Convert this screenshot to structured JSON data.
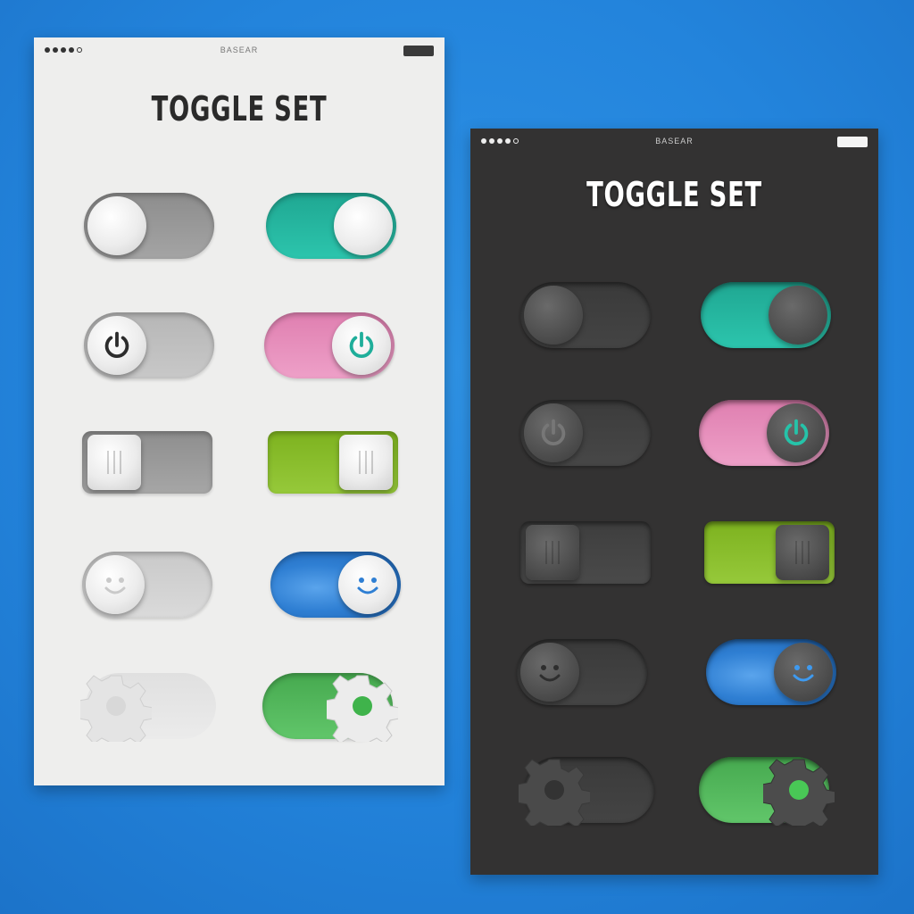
{
  "light_phone": {
    "carrier": "BASEAR",
    "title": "TOGGLE SET"
  },
  "dark_phone": {
    "carrier": "BASEAR",
    "title": "TOGGLE SET"
  },
  "colors": {
    "teal": "#27bea6",
    "pink": "#e890bd",
    "lime": "#8cbe2a",
    "blue": "#3e8fe0",
    "green": "#55bf5f"
  },
  "toggles": [
    {
      "row": 1,
      "style": "plain",
      "icon": "none",
      "off_state": "off",
      "on_state": "on",
      "on_color": "teal"
    },
    {
      "row": 2,
      "style": "power",
      "icon": "power-icon",
      "off_state": "off",
      "on_state": "on",
      "on_color": "pink"
    },
    {
      "row": 3,
      "style": "grip",
      "icon": "grip-icon",
      "off_state": "off",
      "on_state": "on",
      "on_color": "lime"
    },
    {
      "row": 4,
      "style": "smiley",
      "icon": "smiley-icon",
      "off_state": "off",
      "on_state": "on",
      "on_color": "blue"
    },
    {
      "row": 5,
      "style": "gear",
      "icon": "gear-icon",
      "off_state": "off",
      "on_state": "on",
      "on_color": "green"
    }
  ]
}
